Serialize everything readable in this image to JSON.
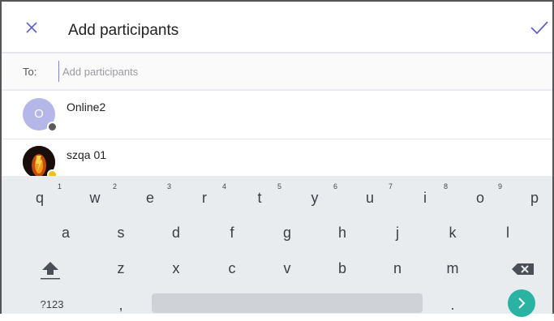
{
  "header": {
    "title": "Add participants",
    "close_icon": "close-icon",
    "done_icon": "check-icon"
  },
  "to_row": {
    "label": "To:",
    "placeholder": "Add participants",
    "value": ""
  },
  "contacts": [
    {
      "name": "Online2",
      "initial": "O",
      "avatar_color": "#b4b7e8",
      "presence_color": "#5a5a5a"
    },
    {
      "name": "szqa 01",
      "initial": "",
      "presence_color": "#f2c01a"
    }
  ],
  "keyboard": {
    "row1": [
      "q",
      "w",
      "e",
      "r",
      "t",
      "y",
      "u",
      "i",
      "o",
      "p"
    ],
    "row1_hints": [
      "1",
      "2",
      "3",
      "4",
      "5",
      "6",
      "7",
      "8",
      "9"
    ],
    "row2": [
      "a",
      "s",
      "d",
      "f",
      "g",
      "h",
      "j",
      "k",
      "l"
    ],
    "row3": [
      "z",
      "x",
      "c",
      "v",
      "b",
      "n",
      "m"
    ],
    "symbols": "?123",
    "comma": ",",
    "period": ".",
    "shift_icon": "shift-icon",
    "backspace_icon": "backspace-icon",
    "go_icon": "chevron-right-icon",
    "accent": "#2ab3a3"
  }
}
